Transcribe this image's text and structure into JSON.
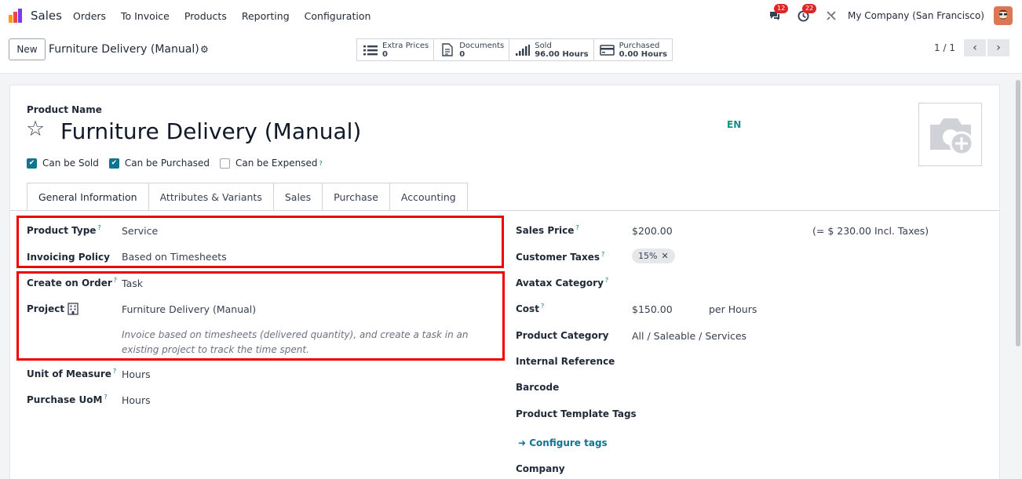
{
  "navbar": {
    "app_name": "Sales",
    "menu": [
      "Orders",
      "To Invoice",
      "Products",
      "Reporting",
      "Configuration"
    ],
    "chat_badge": "12",
    "activity_badge": "22",
    "company": "My Company (San Francisco)"
  },
  "control": {
    "new_label": "New",
    "breadcrumb": "Furniture Delivery (Manual)",
    "smart_buttons": [
      {
        "label": "Extra Prices",
        "value": "0",
        "icon": "list-icon"
      },
      {
        "label": "Documents",
        "value": "0",
        "icon": "document-icon"
      },
      {
        "label": "Sold",
        "value": "96.00 Hours",
        "icon": "signal-bars-icon"
      },
      {
        "label": "Purchased",
        "value": "0.00 Hours",
        "icon": "credit-card-icon"
      }
    ],
    "pager": "1 / 1"
  },
  "form": {
    "product_name_label": "Product Name",
    "product_name": "Furniture Delivery (Manual)",
    "language": "EN",
    "checkboxes": [
      {
        "label": "Can be Sold",
        "checked": true
      },
      {
        "label": "Can be Purchased",
        "checked": true
      },
      {
        "label": "Can be Expensed",
        "checked": false
      }
    ],
    "tabs": [
      "General Information",
      "Attributes & Variants",
      "Sales",
      "Purchase",
      "Accounting"
    ],
    "left": {
      "product_type_label": "Product Type",
      "product_type": "Service",
      "invoicing_policy_label": "Invoicing Policy",
      "invoicing_policy": "Based on Timesheets",
      "create_on_order_label": "Create on Order",
      "create_on_order": "Task",
      "project_label": "Project",
      "project": "Furniture Delivery (Manual)",
      "note": "Invoice based on timesheets (delivered quantity), and create a task in an existing project to track the time spent.",
      "uom_label": "Unit of Measure",
      "uom": "Hours",
      "purchase_uom_label": "Purchase UoM",
      "purchase_uom": "Hours"
    },
    "right": {
      "sales_price_label": "Sales Price",
      "sales_price": "$200.00",
      "incl_taxes": "(= $ 230.00 Incl. Taxes)",
      "customer_taxes_label": "Customer Taxes",
      "tax_tag": "15%",
      "avatax_label": "Avatax Category",
      "cost_label": "Cost",
      "cost": "$150.00",
      "cost_unit": "per Hours",
      "category_label": "Product Category",
      "category": "All / Saleable / Services",
      "internal_ref_label": "Internal Reference",
      "barcode_label": "Barcode",
      "template_tags_label": "Product Template Tags",
      "configure_tags": "Configure tags",
      "company_label": "Company"
    }
  },
  "colors": {
    "accent": "#0e7490",
    "highlight": "#ef0000",
    "badge": "#dc2626"
  }
}
